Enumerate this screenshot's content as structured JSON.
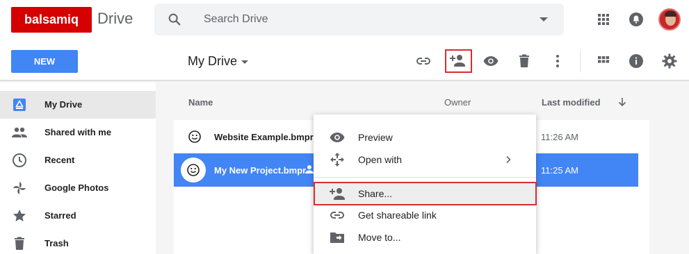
{
  "header": {
    "brand": "balsamiq",
    "app_name": "Drive",
    "search_placeholder": "Search Drive"
  },
  "toolbar": {
    "new_label": "NEW",
    "location_title": "My Drive"
  },
  "sidebar": {
    "items": [
      {
        "label": "My Drive",
        "icon": "drive-icon",
        "active": true
      },
      {
        "label": "Shared with me",
        "icon": "people-icon"
      },
      {
        "label": "Recent",
        "icon": "clock-icon"
      },
      {
        "label": "Google Photos",
        "icon": "pinwheel-icon"
      },
      {
        "label": "Starred",
        "icon": "star-icon"
      },
      {
        "label": "Trash",
        "icon": "trash-icon"
      }
    ]
  },
  "file_list": {
    "columns": {
      "name": "Name",
      "owner": "Owner",
      "last_modified": "Last modified"
    },
    "rows": [
      {
        "name": "Website Example.bmpr",
        "modified": "11:26 AM",
        "selected": false
      },
      {
        "name": "My New Project.bmpr",
        "modified": "11:25 AM",
        "selected": true
      }
    ]
  },
  "context_menu": {
    "items": [
      {
        "label": "Preview",
        "icon": "eye-icon"
      },
      {
        "label": "Open with",
        "icon": "move-arrows-icon",
        "submenu": true
      },
      {
        "label": "Share...",
        "icon": "person-add-icon",
        "highlighted": true
      },
      {
        "label": "Get shareable link",
        "icon": "link-icon"
      },
      {
        "label": "Move to...",
        "icon": "folder-move-icon"
      }
    ]
  },
  "colors": {
    "brand_red": "#d50000",
    "accent_blue": "#4285f4",
    "highlight_red": "#d32f2f"
  }
}
